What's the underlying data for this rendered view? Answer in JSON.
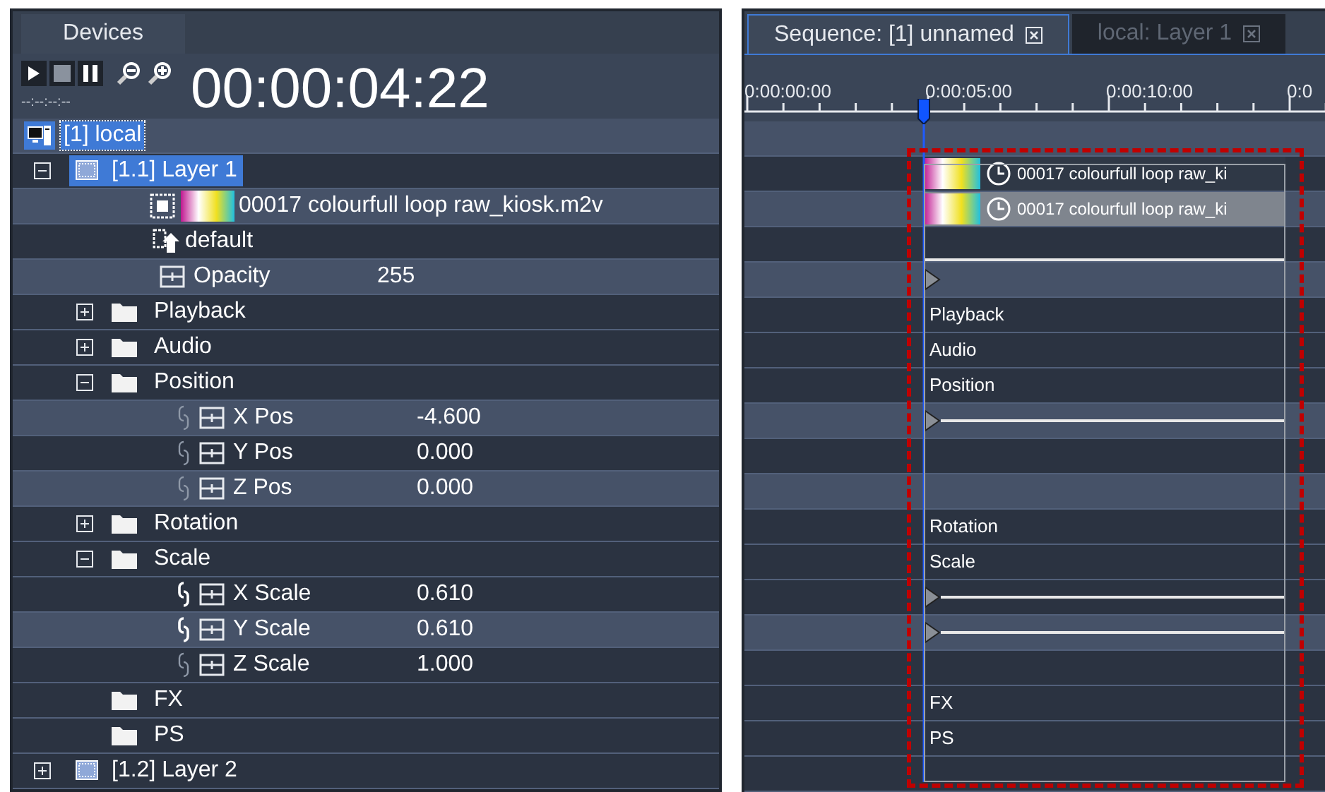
{
  "devices_panel": {
    "tab": "Devices",
    "timecode": "00:00:04:22",
    "timecode_sub": "--:--:--:--",
    "tree": [
      {
        "kind": "device",
        "label": "[1] local",
        "selected": true,
        "children": [
          {
            "kind": "layer",
            "label": "[1.1] Layer 1",
            "selected": true,
            "expanded": true,
            "children": [
              {
                "kind": "clip",
                "label": "00017 colourfull loop raw_kiosk.m2v",
                "selected": false
              },
              {
                "kind": "preset",
                "label": "default",
                "selected": false
              },
              {
                "kind": "parameter",
                "label": "Opacity",
                "value": "255",
                "selected": false
              },
              {
                "kind": "group",
                "label": "Playback",
                "expanded": false,
                "selected": false
              },
              {
                "kind": "group",
                "label": "Audio",
                "expanded": false,
                "selected": false
              },
              {
                "kind": "group",
                "label": "Position",
                "expanded": true,
                "selected": false,
                "children": [
                  {
                    "kind": "parameter",
                    "label": "X Pos",
                    "value": "-4.600",
                    "linked": false,
                    "selected": false
                  },
                  {
                    "kind": "parameter",
                    "label": "Y Pos",
                    "value": "0.000",
                    "linked": false,
                    "selected": false
                  },
                  {
                    "kind": "parameter",
                    "label": "Z Pos",
                    "value": "0.000",
                    "linked": false,
                    "selected": false
                  }
                ]
              },
              {
                "kind": "group",
                "label": "Rotation",
                "expanded": false,
                "selected": false
              },
              {
                "kind": "group",
                "label": "Scale",
                "expanded": true,
                "selected": false,
                "children": [
                  {
                    "kind": "parameter",
                    "label": "X Scale",
                    "value": "0.610",
                    "linked": true,
                    "selected": false
                  },
                  {
                    "kind": "parameter",
                    "label": "Y Scale",
                    "value": "0.610",
                    "linked": true,
                    "selected": false
                  },
                  {
                    "kind": "parameter",
                    "label": "Z Scale",
                    "value": "1.000",
                    "linked": false,
                    "selected": false
                  }
                ]
              },
              {
                "kind": "group",
                "label": "FX",
                "selected": false
              },
              {
                "kind": "group",
                "label": "PS",
                "selected": false
              }
            ]
          },
          {
            "kind": "layer",
            "label": "[1.2] Layer 2",
            "selected": false,
            "expanded": false
          }
        ]
      }
    ]
  },
  "sequence_panel": {
    "tabs": [
      {
        "label": "Sequence: [1] unnamed",
        "selected": true
      },
      {
        "label": "local: Layer 1",
        "selected": false
      }
    ],
    "ruler": [
      "0:00:00:00",
      "0:00:05:00",
      "0:00:10:00",
      "0:0"
    ],
    "rows": [
      {
        "kind": "empty"
      },
      {
        "kind": "clip",
        "label": "00017 colourfull loop raw_ki",
        "selected": false
      },
      {
        "kind": "clip",
        "label": "00017 colourfull loop raw_ki",
        "selected": true
      },
      {
        "kind": "line"
      },
      {
        "kind": "keyframe"
      },
      {
        "kind": "label",
        "label": "Playback"
      },
      {
        "kind": "label",
        "label": "Audio"
      },
      {
        "kind": "label",
        "label": "Position"
      },
      {
        "kind": "keyframe-line"
      },
      {
        "kind": "empty"
      },
      {
        "kind": "empty"
      },
      {
        "kind": "label",
        "label": "Rotation"
      },
      {
        "kind": "label",
        "label": "Scale"
      },
      {
        "kind": "keyframe-line"
      },
      {
        "kind": "keyframe-line"
      },
      {
        "kind": "empty"
      },
      {
        "kind": "label",
        "label": "FX"
      },
      {
        "kind": "label",
        "label": "PS"
      },
      {
        "kind": "empty"
      }
    ]
  }
}
